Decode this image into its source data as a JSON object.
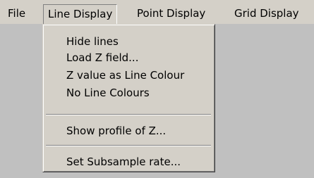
{
  "menubar": {
    "items": [
      {
        "label": "File"
      },
      {
        "label": "Line Display"
      },
      {
        "label": "Point Display"
      },
      {
        "label": "Grid Display"
      }
    ]
  },
  "dropdown": {
    "items": [
      {
        "label": "Hide lines"
      },
      {
        "label": "Load Z field..."
      },
      {
        "label": "Z value as Line Colour"
      },
      {
        "label": "No Line Colours"
      },
      {
        "label": "Show profile of Z..."
      },
      {
        "label": "Set Subsample rate..."
      }
    ]
  },
  "colors": {
    "menu_face": "#d4d0c8",
    "background": "#c0c0c0"
  }
}
